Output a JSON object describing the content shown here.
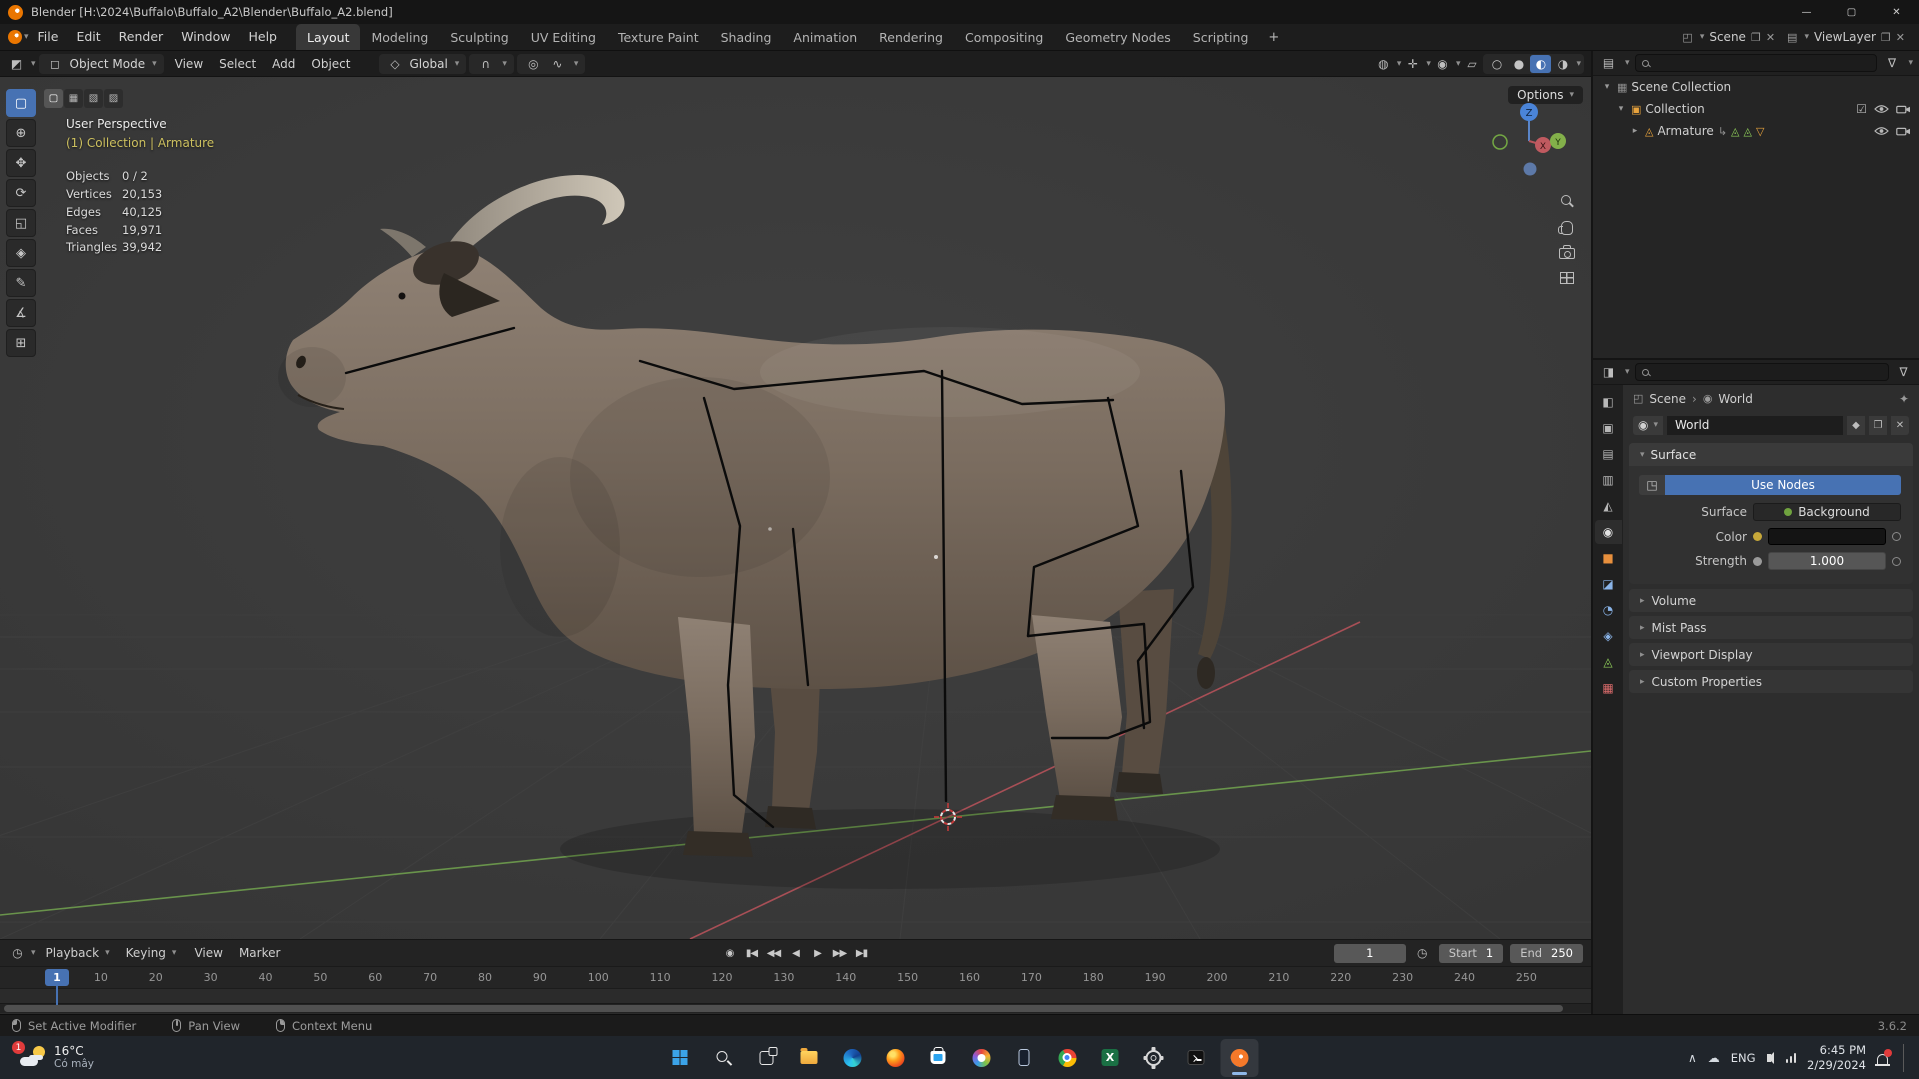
{
  "colors": {
    "accent_blue": "#4772b3",
    "selected_orange": "#e8a33d",
    "axis_x_red": "#b5525a",
    "axis_y_green": "#6f9e4e",
    "axis_z_blue": "#4a84d8",
    "active_name_yellow": "#cdc05f"
  },
  "icons": {
    "chevron_down": "▾",
    "chevron_right": "▸",
    "close": "✕",
    "duplicate": "❐",
    "checkbox_checked": "☑",
    "filter": "∇",
    "pin": "✦",
    "fake_user": "◆",
    "editor_3d_viewport": "◩",
    "editor_properties": "◨",
    "editor_timeline": "◷",
    "object_mode": "◻",
    "orientation_global": "◇",
    "snap_magnet": "∩",
    "proportional": "◎",
    "falloff": "∿",
    "visibility": "◍",
    "gizmos": "✛",
    "overlays": "◉",
    "xray": "▱",
    "shade_wireframe": "○",
    "shade_solid": "●",
    "shade_material": "◐",
    "shade_rendered": "◑",
    "scene_datablock": "◰",
    "viewlayer_datablock": "▤",
    "scene_collection": "▦",
    "collection": "▣",
    "armature_object": "◬",
    "child_of": "↳",
    "pose_bone": "◬",
    "armature_data": "▽",
    "world": "◉",
    "node_tree": "◳",
    "breadcrumb_sep": "›",
    "tray_expand": "∧",
    "cloud": "☁",
    "sync": "◷"
  },
  "titlebar": {
    "title": "Blender [H:\\2024\\Buffalo\\Buffalo_A2\\Blender\\Buffalo_A2.blend]",
    "minimize": "—",
    "maximize": "▢",
    "close": "✕"
  },
  "topbar": {
    "app_menus": [
      "File",
      "Edit",
      "Render",
      "Window",
      "Help"
    ],
    "workspaces": [
      {
        "name": "workspace-tab-layout",
        "label": "Layout",
        "active": true
      },
      {
        "name": "workspace-tab-modeling",
        "label": "Modeling"
      },
      {
        "name": "workspace-tab-sculpting",
        "label": "Sculpting"
      },
      {
        "name": "workspace-tab-uv-editing",
        "label": "UV Editing"
      },
      {
        "name": "workspace-tab-texture-paint",
        "label": "Texture Paint"
      },
      {
        "name": "workspace-tab-shading",
        "label": "Shading"
      },
      {
        "name": "workspace-tab-animation",
        "label": "Animation"
      },
      {
        "name": "workspace-tab-rendering",
        "label": "Rendering"
      },
      {
        "name": "workspace-tab-compositing",
        "label": "Compositing"
      },
      {
        "name": "workspace-tab-geometry-nodes",
        "label": "Geometry Nodes"
      },
      {
        "name": "workspace-tab-scripting",
        "label": "Scripting"
      }
    ],
    "add_workspace": "+",
    "scene_label": "Scene",
    "viewlayer_label": "ViewLayer"
  },
  "viewport_header": {
    "mode": "Object Mode",
    "menus": [
      "View",
      "Select",
      "Add",
      "Object"
    ],
    "orientation": "Global"
  },
  "tools": [
    {
      "name": "tool-select-box",
      "glyph": "▢",
      "active": true
    },
    {
      "name": "tool-cursor",
      "glyph": "⊕"
    },
    {
      "name": "tool-move",
      "glyph": "✥"
    },
    {
      "name": "tool-rotate",
      "glyph": "⟳"
    },
    {
      "name": "tool-scale",
      "glyph": "◱"
    },
    {
      "name": "tool-transform",
      "glyph": "◈"
    },
    {
      "name": "tool-annotate",
      "glyph": "✎"
    },
    {
      "name": "tool-measure",
      "glyph": "∡"
    },
    {
      "name": "tool-add-cube",
      "glyph": "⊞"
    }
  ],
  "viewport": {
    "select_modes": [
      {
        "name": "select-mode-new",
        "glyph": "▢",
        "active": true
      },
      {
        "name": "select-mode-extend",
        "glyph": "▦"
      },
      {
        "name": "select-mode-subtract",
        "glyph": "▧"
      },
      {
        "name": "select-mode-intersect",
        "glyph": "▨"
      }
    ],
    "options_label": "Options",
    "overlay_title": "User Perspective",
    "overlay_context": "(1) Collection | Armature",
    "stats": [
      {
        "label": "Objects",
        "value": "0 / 2"
      },
      {
        "label": "Vertices",
        "value": "20,153"
      },
      {
        "label": "Edges",
        "value": "40,125"
      },
      {
        "label": "Faces",
        "value": "19,971"
      },
      {
        "label": "Triangles",
        "value": "39,942"
      }
    ],
    "gizmo_axes": {
      "x": "X",
      "y": "Y",
      "z": "Z"
    }
  },
  "outliner": {
    "scene_collection": "Scene Collection",
    "collection": "Collection",
    "armature": "Armature"
  },
  "properties": {
    "tabs": [
      {
        "name": "properties-tab-tool",
        "glyph": "◧",
        "color": "#b8b8b8"
      },
      {
        "name": "properties-tab-render",
        "glyph": "▣",
        "color": "#b8b8b8"
      },
      {
        "name": "properties-tab-output",
        "glyph": "▤",
        "color": "#b8b8b8"
      },
      {
        "name": "properties-tab-view-layer",
        "glyph": "▥",
        "color": "#b8b8b8"
      },
      {
        "name": "properties-tab-scene",
        "glyph": "◭",
        "color": "#b8b8b8"
      },
      {
        "name": "properties-tab-world",
        "glyph": "◉",
        "color": "#e2e2e2",
        "active": true
      },
      {
        "name": "properties-tab-object",
        "glyph": "■",
        "color": "#e8903d"
      },
      {
        "name": "properties-tab-modifiers",
        "glyph": "◪",
        "color": "#8ab4e8"
      },
      {
        "name": "properties-tab-physics",
        "glyph": "◔",
        "color": "#8ab4e8"
      },
      {
        "name": "properties-tab-constraints",
        "glyph": "◈",
        "color": "#8ab4e8"
      },
      {
        "name": "properties-tab-data",
        "glyph": "◬",
        "color": "#8fce5a"
      },
      {
        "name": "properties-tab-texture",
        "glyph": "▦",
        "color": "#d86a6a"
      }
    ],
    "breadcrumb_scene": "Scene",
    "breadcrumb_world": "World",
    "world_name": "World",
    "surface_title": "Surface",
    "use_nodes": "Use Nodes",
    "surface_label": "Surface",
    "surface_value": "Background",
    "color_label": "Color",
    "strength_label": "Strength",
    "strength_value": "1.000",
    "sections": [
      "Volume",
      "Mist Pass",
      "Viewport Display",
      "Custom Properties"
    ]
  },
  "timeline": {
    "menus_dd": [
      "Playback",
      "Keying"
    ],
    "menus_plain": [
      "View",
      "Marker"
    ],
    "transport": [
      {
        "name": "record-button",
        "glyph": "◉"
      },
      {
        "name": "jump-start-button",
        "glyph": "▮◀"
      },
      {
        "name": "prev-keyframe-button",
        "glyph": "◀◀"
      },
      {
        "name": "play-reverse-button",
        "glyph": "◀"
      },
      {
        "name": "play-button",
        "glyph": "▶"
      },
      {
        "name": "next-keyframe-button",
        "glyph": "▶▶"
      },
      {
        "name": "jump-end-button",
        "glyph": "▶▮"
      }
    ],
    "current_frame": "1",
    "start_label": "Start",
    "start_value": "1",
    "end_label": "End",
    "end_value": "250",
    "ticks": [
      "1",
      "10",
      "20",
      "30",
      "40",
      "50",
      "60",
      "70",
      "80",
      "90",
      "100",
      "110",
      "120",
      "130",
      "140",
      "150",
      "160",
      "170",
      "180",
      "190",
      "200",
      "210",
      "220",
      "230",
      "240",
      "250"
    ]
  },
  "statusbar": {
    "hints": [
      {
        "name": "status-hint-left-click",
        "cls": "left",
        "label": "Set Active Modifier"
      },
      {
        "name": "status-hint-middle-click",
        "cls": "middle",
        "label": "Pan View"
      },
      {
        "name": "status-hint-right-click",
        "cls": "right",
        "label": "Context Menu"
      }
    ],
    "version": "3.6.2"
  },
  "taskbar": {
    "weather_temp": "16°C",
    "weather_condition": "Có mây",
    "weather_badge": "1",
    "apps": [
      "start",
      "search",
      "task-view",
      "file-explorer",
      "edge",
      "firefox",
      "store",
      "photos",
      "phone-link",
      "chrome",
      "excel",
      "settings",
      "terminal",
      "blender"
    ],
    "tray_language": "ENG",
    "tray_time": "6:45 PM",
    "tray_date": "2/29/2024"
  }
}
